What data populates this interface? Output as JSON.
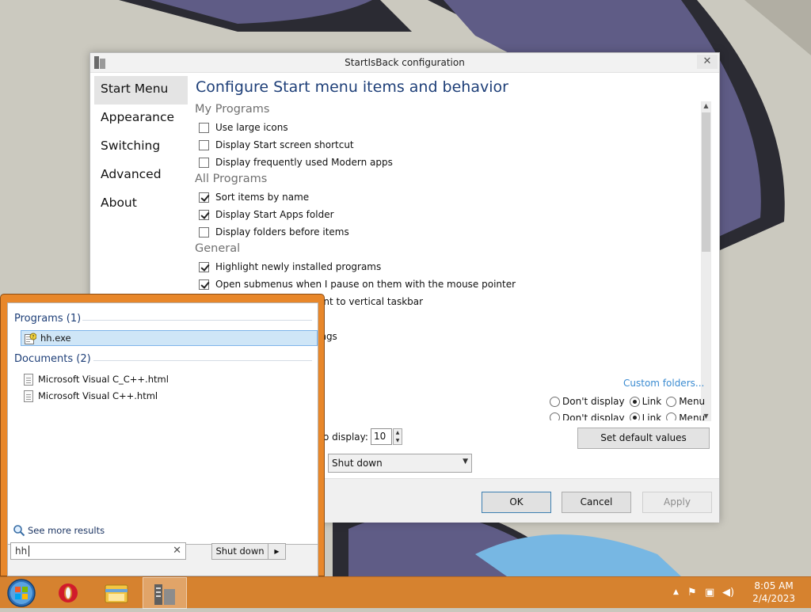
{
  "window": {
    "title": "StartIsBack configuration",
    "close": "✕",
    "heading": "Configure Start menu items and behavior",
    "nav": [
      "Start Menu",
      "Appearance",
      "Switching",
      "Advanced",
      "About"
    ],
    "sections": [
      {
        "title": "My Programs",
        "items": [
          {
            "label": "Use large icons",
            "checked": false
          },
          {
            "label": "Display Start screen shortcut",
            "checked": false
          },
          {
            "label": "Display frequently used Modern apps",
            "checked": false
          }
        ]
      },
      {
        "title": "All Programs",
        "items": [
          {
            "label": "Sort items by name",
            "checked": true
          },
          {
            "label": "Display Start Apps folder",
            "checked": true
          },
          {
            "label": "Display folders before items",
            "checked": false
          }
        ]
      },
      {
        "title": "General",
        "items": [
          {
            "label": "Highlight newly installed programs",
            "checked": true
          },
          {
            "label": "Open submenus when I pause on them with the mouse pointer",
            "checked": true
          },
          {
            "label": "ent to vertical taskbar",
            "checked": false
          },
          {
            "label": "",
            "checked": false
          },
          {
            "label": "ings",
            "checked": false
          }
        ]
      }
    ],
    "custom_folders": "Custom folders...",
    "radio_rows": [
      {
        "options": [
          "Don't display",
          "Link",
          "Menu"
        ],
        "selected": 1
      },
      {
        "options": [
          "Don't display",
          "Link",
          "Menu"
        ],
        "selected": 1
      }
    ],
    "spin_label": "o display:",
    "spin_value": "10",
    "set_default": "Set default values",
    "power_select": "Shut down",
    "ok": "OK",
    "cancel": "Cancel",
    "apply": "Apply"
  },
  "startmenu": {
    "programs_header": "Programs (1)",
    "programs": [
      "hh.exe"
    ],
    "documents_header": "Documents (2)",
    "documents": [
      "Microsoft Visual C_C++.html",
      "Microsoft Visual C++.html"
    ],
    "see_more": "See more results",
    "search_value": "hh",
    "search_clear": "✕",
    "shutdown": "Shut down"
  },
  "taskbar": {
    "time": "8:05 AM",
    "date": "2/4/2023",
    "pinned": [
      "start-orb",
      "opera-icon",
      "file-explorer-icon",
      "startisback-config-icon"
    ]
  },
  "colors": {
    "taskbar": "#d6822f",
    "heading": "#1e3f78",
    "link": "#3a8bd1"
  }
}
